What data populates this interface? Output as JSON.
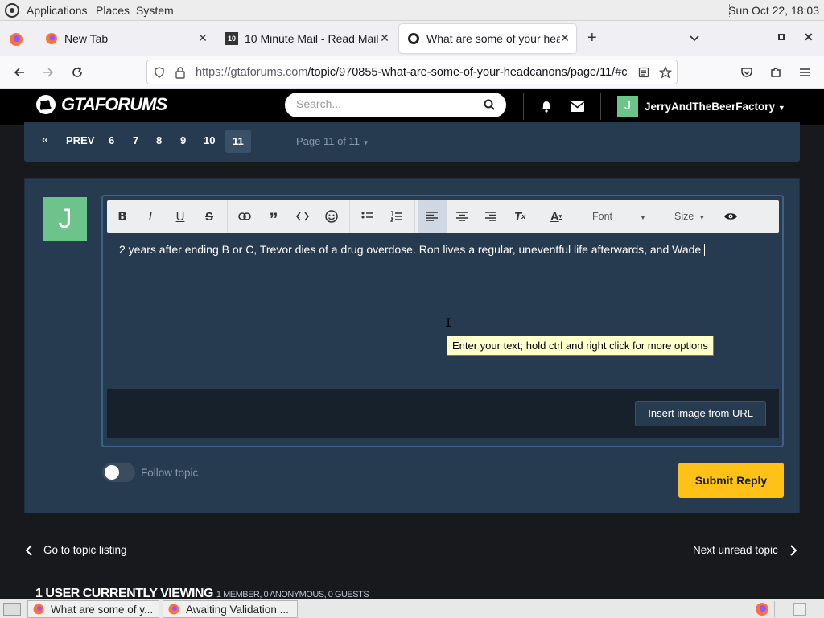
{
  "desktop": {
    "menus": [
      "Applications",
      "Places",
      "System"
    ],
    "clock": "Sun Oct 22, 18:03"
  },
  "browser": {
    "tabs": [
      {
        "label": "New Tab"
      },
      {
        "label": "10 Minute Mail - Read Mail",
        "favicon_text": "10"
      },
      {
        "label": "What are some of your head"
      }
    ],
    "url_host": "https://gtaforums.com",
    "url_path": "/topic/970855-what-are-some-of-your-headcanons/page/11/#c"
  },
  "site": {
    "brand": "GTAFORUMS",
    "search_placeholder": "Search...",
    "user": {
      "initial": "J",
      "name": "JerryAndTheBeerFactory"
    }
  },
  "pagination": {
    "prev_label": "PREV",
    "pages": [
      "6",
      "7",
      "8",
      "9",
      "10",
      "11"
    ],
    "current": "11",
    "page_of": "Page 11 of 11"
  },
  "reply": {
    "avatar_initial": "J",
    "toolbar": {
      "font_label": "Font",
      "size_label": "Size"
    },
    "text": "2 years after ending B or C, Trevor dies of a drug overdose. Ron lives a regular, uneventful life afterwards, and Wade ",
    "tooltip": "Enter your text; hold ctrl and right click for more options",
    "insert_image_label": "Insert image from URL",
    "follow_label": "Follow topic",
    "submit_label": "Submit Reply"
  },
  "topic_nav": {
    "back_label": "Go to topic listing",
    "next_label": "Next unread topic"
  },
  "viewing": {
    "title": "1 USER CURRENTLY VIEWING",
    "detail": "1 MEMBER, 0 ANONYMOUS, 0 GUESTS"
  },
  "taskbar": {
    "items": [
      "What are some of y...",
      "Awaiting Validation ..."
    ]
  },
  "colors": {
    "accent_yellow": "#fdc118",
    "avatar_green": "#6cc48a",
    "panel_blue": "#273b50"
  }
}
